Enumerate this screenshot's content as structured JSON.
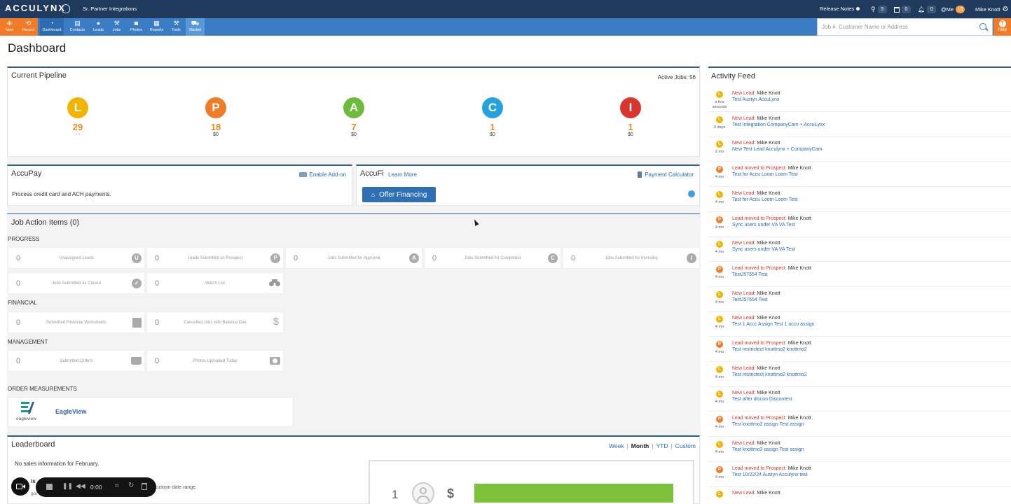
{
  "topbar": {
    "logo": "ACCULYNX",
    "tenant": "Sr. Partner Integrations",
    "release_notes": "Release Notes",
    "pin_count": "3",
    "calendar_count": "0",
    "bell_count": "0",
    "me_label": "@Me",
    "me_count": "15",
    "user_name": "Mike Knott"
  },
  "nav": {
    "items": [
      {
        "label": "New",
        "icon": "plus-icon"
      },
      {
        "label": "Recent",
        "icon": "recent-icon"
      },
      {
        "label": "Dashboard",
        "icon": "dashboard-icon"
      },
      {
        "label": "Contacts",
        "icon": "contacts-icon"
      },
      {
        "label": "Leads",
        "icon": "leads-icon"
      },
      {
        "label": "Jobs",
        "icon": "jobs-icon"
      },
      {
        "label": "Photos",
        "icon": "camera-icon"
      },
      {
        "label": "Reports",
        "icon": "reports-icon"
      },
      {
        "label": "Tools",
        "icon": "wrench-icon"
      },
      {
        "label": "Market",
        "icon": "market-icon"
      }
    ],
    "search_placeholder": "Job #, Customer Name or Address",
    "help_label": "Help"
  },
  "page": {
    "title": "Dashboard"
  },
  "pipeline": {
    "title": "Current Pipeline",
    "active_jobs": "Active Jobs: 56",
    "stages": [
      {
        "letter": "L",
        "count": "29",
        "amount": "- -",
        "color": "#f2b400",
        "num_color": "#e68a1e"
      },
      {
        "letter": "P",
        "count": "18",
        "amount": "$0",
        "color": "#f07c28",
        "num_color": "#e68a1e"
      },
      {
        "letter": "A",
        "count": "7",
        "amount": "$0",
        "color": "#6cbb3c",
        "num_color": "#e68a1e"
      },
      {
        "letter": "C",
        "count": "1",
        "amount": "$0",
        "color": "#26a3dd",
        "num_color": "#e68a1e"
      },
      {
        "letter": "I",
        "count": "1",
        "amount": "$0",
        "color": "#d9352c",
        "num_color": "#e68a1e"
      }
    ]
  },
  "accupay": {
    "title": "AccuPay",
    "enable_addon": "Enable Add-on",
    "description": "Process credit card and ACH payments."
  },
  "accufi": {
    "title": "AccuFi",
    "learn_more": "Learn More",
    "payment_calculator": "Payment Calculator",
    "offer_financing": "Offer Financing"
  },
  "job_actions": {
    "title": "Job Action Items (0)",
    "progress_label": "PROGRESS",
    "financial_label": "FINANCIAL",
    "management_label": "MANAGEMENT",
    "order_label": "ORDER MEASUREMENTS",
    "progress": [
      {
        "num": "0",
        "label": "Unassigned Leads",
        "icon": "U"
      },
      {
        "num": "0",
        "label": "Leads Submitted as Prospect",
        "icon": "P"
      },
      {
        "num": "0",
        "label": "Jobs Submitted for Approval",
        "icon": "A"
      },
      {
        "num": "0",
        "label": "Jobs Submitted for Completed",
        "icon": "C"
      },
      {
        "num": "0",
        "label": "Jobs Submitted for Invoicing",
        "icon": "I"
      },
      {
        "num": "0",
        "label": "Jobs Submitted as Closed",
        "icon": "✓"
      },
      {
        "num": "0",
        "label": "Watch List",
        "icon": "binoculars"
      }
    ],
    "financial": [
      {
        "num": "0",
        "label": "Submitted Financial Worksheets"
      },
      {
        "num": "0",
        "label": "Cancelled Jobs with Balance Due"
      }
    ],
    "management": [
      {
        "num": "0",
        "label": "Submitted Orders"
      },
      {
        "num": "0",
        "label": "Photos Uploaded Today"
      }
    ],
    "eagleview": {
      "logo_text": "eagleview",
      "name": "EagleView"
    }
  },
  "leaderboard": {
    "title": "Leaderboard",
    "filters": [
      "Week",
      "Month",
      "YTD",
      "Custom"
    ],
    "active_filter": "Month",
    "no_sales": "No sales information for February.",
    "hint_title": "is",
    "hint_text": "custom date range.",
    "hint_text2": "gor",
    "rank": "1",
    "currency": "$"
  },
  "recorder": {
    "time": "0:00"
  },
  "activity_feed": {
    "title": "Activity Feed",
    "items": [
      {
        "letter": "L",
        "type": "New Lead:",
        "user": "Mike Knott",
        "job": "Test Austyn AccuLynx",
        "time": "a few seconds"
      },
      {
        "letter": "L",
        "type": "New Lead:",
        "user": "Mike Knott",
        "job": "Test Integration CompanyCam + AccuLynx",
        "time": "3 days"
      },
      {
        "letter": "L",
        "type": "New Lead:",
        "user": "Mike Knott",
        "job": "New Test Lead Acculynx + CompanyCam",
        "time": "2 mo"
      },
      {
        "letter": "P",
        "type": "Lead moved to Prospect:",
        "user": "Mike Knott",
        "job": "Test for Accu Loom Loom Test",
        "time": "4 mo"
      },
      {
        "letter": "L",
        "type": "New Lead:",
        "user": "Mike Knott",
        "job": "Test for Accu Loom Loom Test",
        "time": "4 mo"
      },
      {
        "letter": "P",
        "type": "Lead moved to Prospect:",
        "user": "Mike Knott",
        "job": "Sync users under VA VA Test",
        "time": "4 mo"
      },
      {
        "letter": "L",
        "type": "New Lead:",
        "user": "Mike Knott",
        "job": "Sync users under VA VA Test",
        "time": "4 mo"
      },
      {
        "letter": "P",
        "type": "Lead moved to Prospect:",
        "user": "Mike Knott",
        "job": "TestJ57654 Test",
        "time": "4 mo"
      },
      {
        "letter": "L",
        "type": "New Lead:",
        "user": "Mike Knott",
        "job": "TestJ57654 Test",
        "time": "4 mo"
      },
      {
        "letter": "L",
        "type": "New Lead:",
        "user": "Mike Knott",
        "job": "Test 1 Accc Assign Test 1 accu assign",
        "time": "4 mo"
      },
      {
        "letter": "P",
        "type": "Lead moved to Prospect:",
        "user": "Mike Knott",
        "job": "Test restrictect knottmo2 knottmo2",
        "time": "4 mo"
      },
      {
        "letter": "L",
        "type": "New Lead:",
        "user": "Mike Knott",
        "job": "Test restrictect knottmo2 knottmo2",
        "time": "4 mo"
      },
      {
        "letter": "L",
        "type": "New Lead:",
        "user": "Mike Knott",
        "job": "Test after discon Discontest",
        "time": "4 mo"
      },
      {
        "letter": "P",
        "type": "Lead moved to Prospect:",
        "user": "Mike Knott",
        "job": "Test knottmo2 assign Test assign",
        "time": "4 mo"
      },
      {
        "letter": "L",
        "type": "New Lead:",
        "user": "Mike Knott",
        "job": "Test knottmo2 assign Test assign",
        "time": "4 mo"
      },
      {
        "letter": "P",
        "type": "Lead moved to Prospect:",
        "user": "Mike Knott",
        "job": "Test 10/22/24 Austyn Acculynx test",
        "time": "4 mo"
      },
      {
        "letter": "L",
        "type": "New Lead:",
        "user": "Mike Knott",
        "job": "",
        "time": ""
      }
    ]
  }
}
